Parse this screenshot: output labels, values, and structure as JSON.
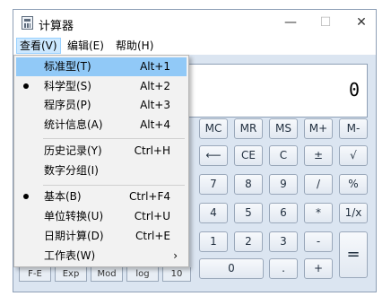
{
  "window": {
    "title": "计算器",
    "minimize": "—",
    "maximize": "☐",
    "close": "✕"
  },
  "menubar": [
    "查看(V)",
    "编辑(E)",
    "帮助(H)"
  ],
  "display": {
    "value": "0"
  },
  "keys": {
    "mc": "MC",
    "mr": "MR",
    "ms": "MS",
    "mplus": "M+",
    "mminus": "M-",
    "backspace": "⟵",
    "ce": "CE",
    "c": "C",
    "plusminus": "±",
    "sqrt": "√",
    "k7": "7",
    "k8": "8",
    "k9": "9",
    "div": "/",
    "pct": "%",
    "k4": "4",
    "k5": "5",
    "k6": "6",
    "mul": "*",
    "recip": "1/x",
    "k1": "1",
    "k2": "2",
    "k3": "3",
    "sub": "-",
    "eq": "=",
    "k0": "0",
    "dot": ".",
    "add": "+"
  },
  "sci_keys_partial": [
    "F-E",
    "Exp",
    "Mod",
    "log",
    "10"
  ],
  "view_menu": {
    "items": [
      {
        "label": "标准型(T)",
        "accel": "Alt+1",
        "checked": false,
        "highlighted": true
      },
      {
        "label": "科学型(S)",
        "accel": "Alt+2",
        "checked": true,
        "highlighted": false
      },
      {
        "label": "程序员(P)",
        "accel": "Alt+3",
        "checked": false,
        "highlighted": false
      },
      {
        "label": "统计信息(A)",
        "accel": "Alt+4",
        "checked": false,
        "highlighted": false
      },
      {
        "label": "历史记录(Y)",
        "accel": "Ctrl+H",
        "checked": false,
        "highlighted": false
      },
      {
        "label": "数字分组(I)",
        "accel": "",
        "checked": false,
        "highlighted": false
      },
      {
        "label": "基本(B)",
        "accel": "Ctrl+F4",
        "checked": true,
        "highlighted": false
      },
      {
        "label": "单位转换(U)",
        "accel": "Ctrl+U",
        "checked": false,
        "highlighted": false
      },
      {
        "label": "日期计算(D)",
        "accel": "Ctrl+E",
        "checked": false,
        "highlighted": false
      },
      {
        "label": "工作表(W)",
        "accel": "",
        "checked": false,
        "highlighted": false,
        "submenu_arrow": "›"
      }
    ]
  }
}
